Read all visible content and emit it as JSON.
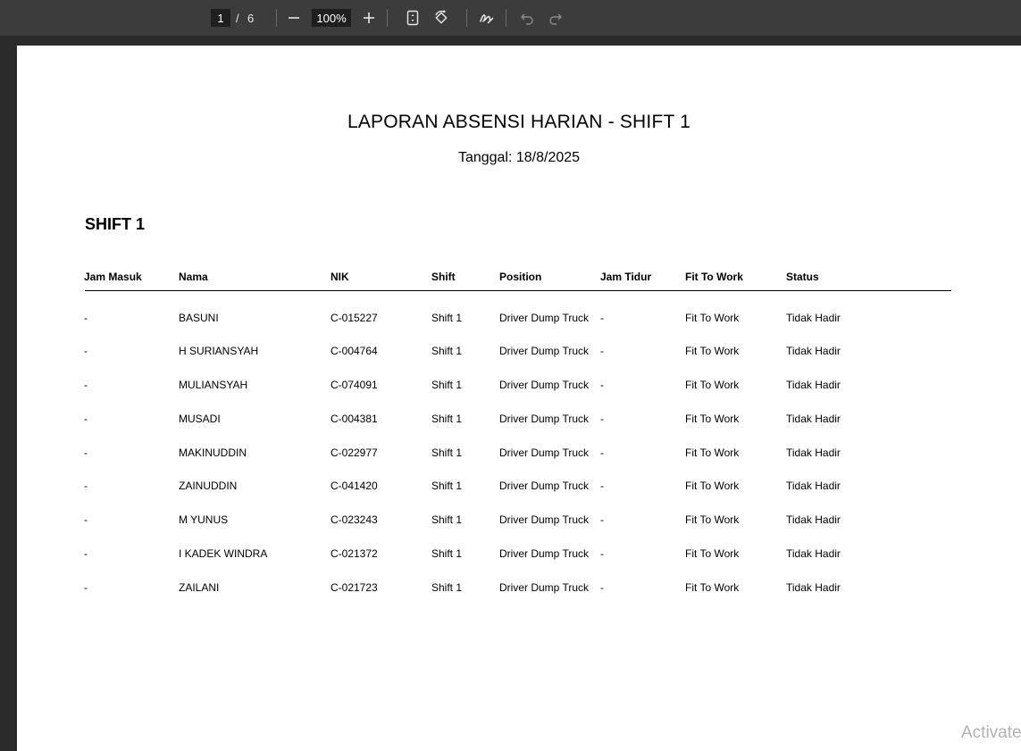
{
  "toolbar": {
    "page_current": "1",
    "page_separator": "/",
    "page_total": "6",
    "zoom": "100%",
    "icons": [
      "zoom-out-icon",
      "zoom-in-icon",
      "fit-page-icon",
      "rotate-icon",
      "annotate-icon",
      "undo-icon",
      "redo-icon"
    ]
  },
  "document": {
    "title": "LAPORAN ABSENSI HARIAN - SHIFT 1",
    "date": "Tanggal: 18/8/2025",
    "section_title": "SHIFT 1",
    "columns": [
      "Jam Masuk",
      "Nama",
      "NIK",
      "Shift",
      "Position",
      "Jam Tidur",
      "Fit To Work",
      "Status"
    ],
    "rows": [
      [
        "-",
        "BASUNI",
        "C-015227",
        "Shift 1",
        "Driver Dump Truck",
        "-",
        "Fit To Work",
        "Tidak Hadir"
      ],
      [
        "-",
        "H SURIANSYAH",
        "C-004764",
        "Shift 1",
        "Driver Dump Truck",
        "-",
        "Fit To Work",
        "Tidak Hadir"
      ],
      [
        "-",
        "MULIANSYAH",
        "C-074091",
        "Shift 1",
        "Driver Dump Truck",
        "-",
        "Fit To Work",
        "Tidak Hadir"
      ],
      [
        "-",
        "MUSADI",
        "C-004381",
        "Shift 1",
        "Driver Dump Truck",
        "-",
        "Fit To Work",
        "Tidak Hadir"
      ],
      [
        "-",
        "MAKINUDDIN",
        "C-022977",
        "Shift 1",
        "Driver Dump Truck",
        "-",
        "Fit To Work",
        "Tidak Hadir"
      ],
      [
        "-",
        "ZAINUDDIN",
        "C-041420",
        "Shift 1",
        "Driver Dump Truck",
        "-",
        "Fit To Work",
        "Tidak Hadir"
      ],
      [
        "-",
        "M YUNUS",
        "C-023243",
        "Shift 1",
        "Driver Dump Truck",
        "-",
        "Fit To Work",
        "Tidak Hadir"
      ],
      [
        "-",
        "I KADEK WINDRA",
        "C-021372",
        "Shift 1",
        "Driver Dump Truck",
        "-",
        "Fit To Work",
        "Tidak Hadir"
      ],
      [
        "-",
        "ZAILANI",
        "C-021723",
        "Shift 1",
        "Driver Dump Truck",
        "-",
        "Fit To Work",
        "Tidak Hadir"
      ]
    ]
  },
  "watermark": "Activate",
  "colors": {
    "toolbar_bg": "#3c3c3c",
    "viewer_bg": "#2b2b2b",
    "page_bg": "#ffffff"
  }
}
